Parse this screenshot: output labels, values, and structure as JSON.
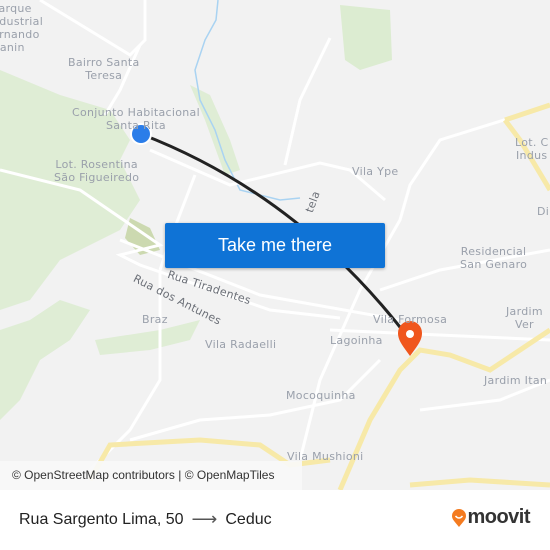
{
  "map": {
    "labels": {
      "parque_industrial": "Parque\nndustrial\nernando\nZanin",
      "santa_teresa": "Bairro Santa\nTeresa",
      "santa_rita": "Conjunto Habitacional\nSanta Rita",
      "rosentina": "Lot. Rosentina\nSão Figueiredo",
      "vila_ype": "Vila Ype",
      "lot_c": "Lot. C\nIndus",
      "di": "Di",
      "san_genaro": "Residencial\nSan Genaro",
      "braz": "Braz",
      "vila_radaelli": "Vila Radaelli",
      "lagoinha": "Lagoinha",
      "vila_formosa": "Vila Formosa",
      "jardim_ver": "Jardim\nVer",
      "jardim_itan": "Jardim Itan",
      "mocoquinha": "Mocoquinha",
      "vila_mushioni": "Vila Mushioni"
    },
    "streets": {
      "tiradentes": "Rua Tiradentes",
      "antunes": "Rua dos Antunes",
      "tela": "tela"
    },
    "colors": {
      "route": "#222222",
      "origin": "#2b7de9",
      "destination": "#f0561d",
      "major_road": "#f7e9a8",
      "park": "#d9ebcd",
      "water": "#a9d3f2"
    }
  },
  "cta": {
    "label": "Take me there"
  },
  "attribution": "© OpenStreetMap contributors | © OpenMapTiles",
  "footer": {
    "origin": "Rua Sargento Lima, 50",
    "arrow": "⟶",
    "destination": "Ceduc",
    "brand": "moovit"
  }
}
